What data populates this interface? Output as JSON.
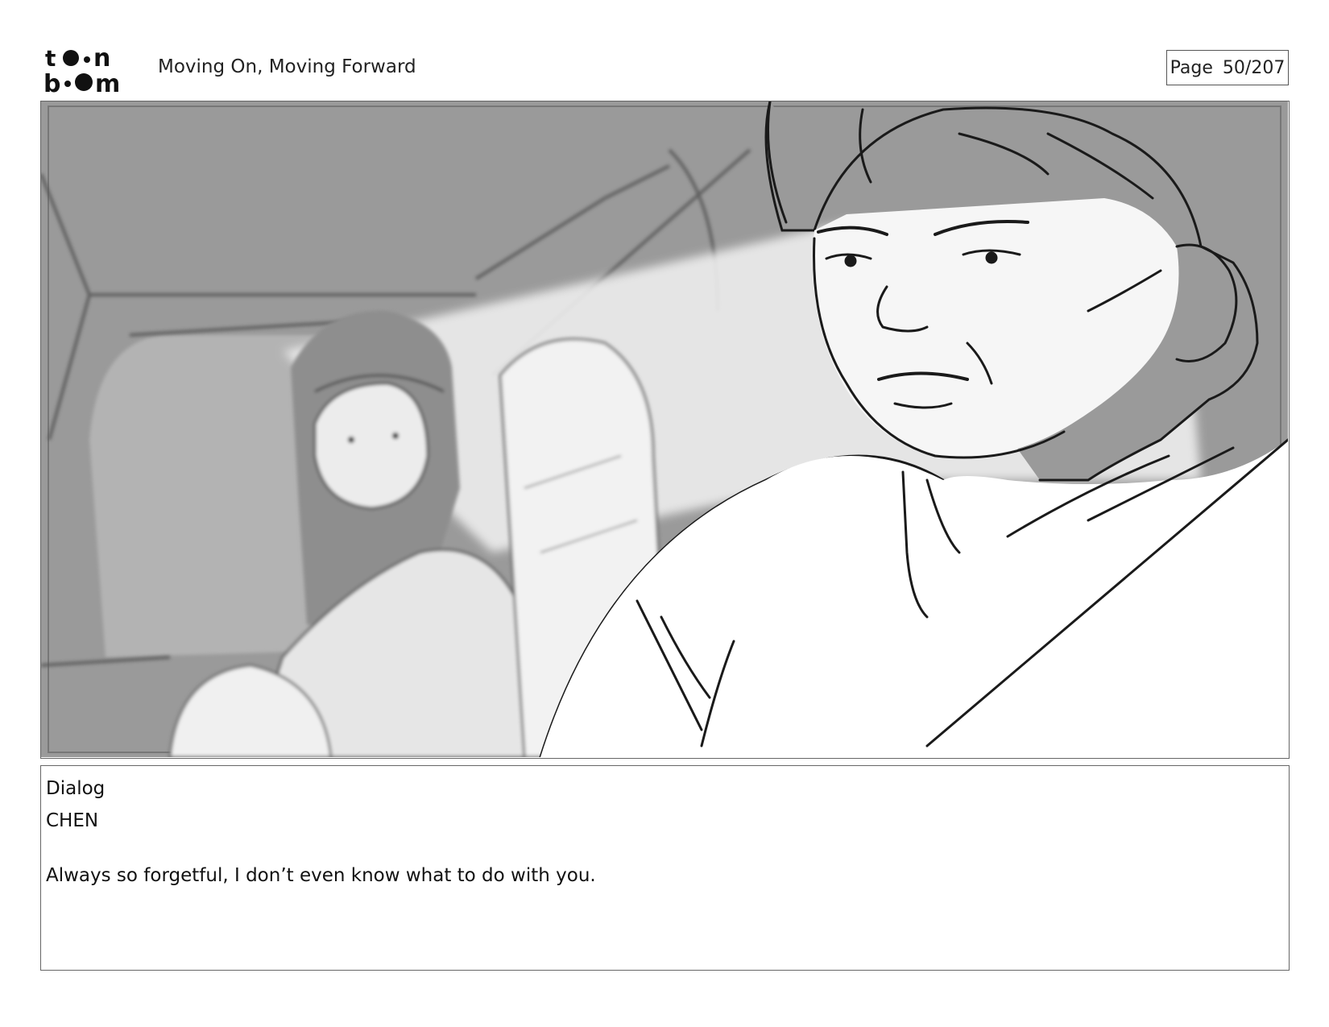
{
  "header": {
    "logo_text": "toon boom",
    "title": "Moving On, Moving Forward",
    "page_label": "Page",
    "page_number": "50/207"
  },
  "panel": {
    "icon": "storyboard-sketch-image"
  },
  "dialog": {
    "heading": "Dialog",
    "speaker": "CHEN",
    "text": "Always so forgetful, I don’t even know what to do with you."
  }
}
